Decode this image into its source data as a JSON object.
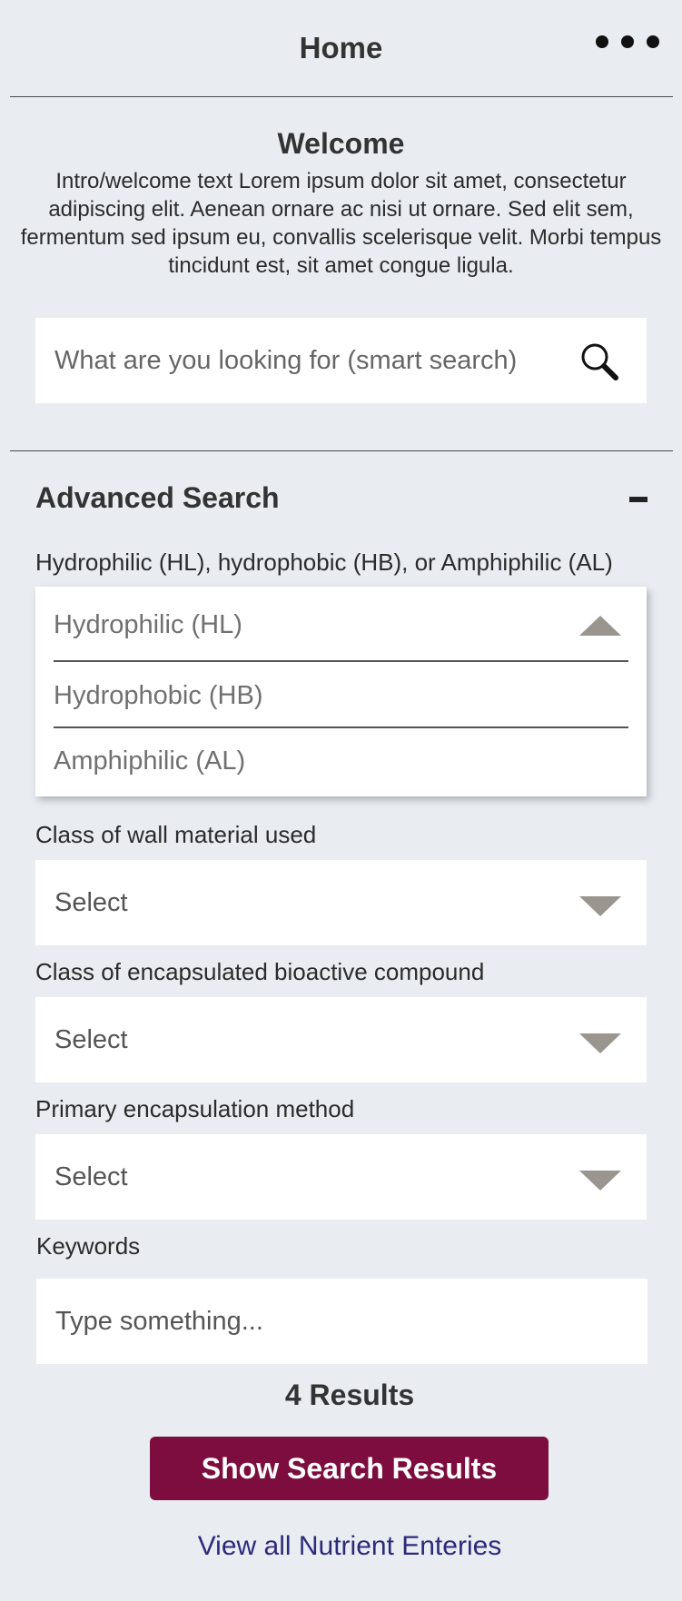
{
  "header": {
    "title": "Home",
    "menu_icon": "more-horizontal-icon"
  },
  "welcome": {
    "title": "Welcome",
    "text": "Intro/welcome text Lorem ipsum dolor sit amet, consectetur adipiscing elit. Aenean ornare ac nisi ut ornare. Sed elit sem, fermentum sed ipsum eu, convallis scelerisque velit. Morbi tempus tincidunt est, sit amet congue ligula."
  },
  "search": {
    "placeholder": "What are you looking for (smart search)",
    "icon": "search-icon"
  },
  "advanced": {
    "title": "Advanced Search",
    "collapse_icon": "minus-icon",
    "hydro": {
      "label": "Hydrophilic (HL), hydrophobic (HB), or Amphiphilic (AL)",
      "options": [
        "Hydrophilic (HL)",
        "Hydrophobic (HB)",
        "Amphiphilic (AL)"
      ]
    },
    "wall": {
      "label": "Class of wall material used",
      "value": "Select"
    },
    "compound": {
      "label": "Class of encapsulated bioactive compound",
      "value": "Select"
    },
    "method": {
      "label": "Primary encapsulation method",
      "value": "Select"
    },
    "keywords": {
      "label": "Keywords",
      "placeholder": "Type something..."
    }
  },
  "results": {
    "count_text": "4 Results"
  },
  "buttons": {
    "show_results": "Show Search Results",
    "view_all": "View all Nutrient Enteries"
  },
  "colors": {
    "background": "#e9edf2",
    "primary": "#7c0d3e",
    "link": "#2e2a7a",
    "caret": "#9a958f"
  }
}
